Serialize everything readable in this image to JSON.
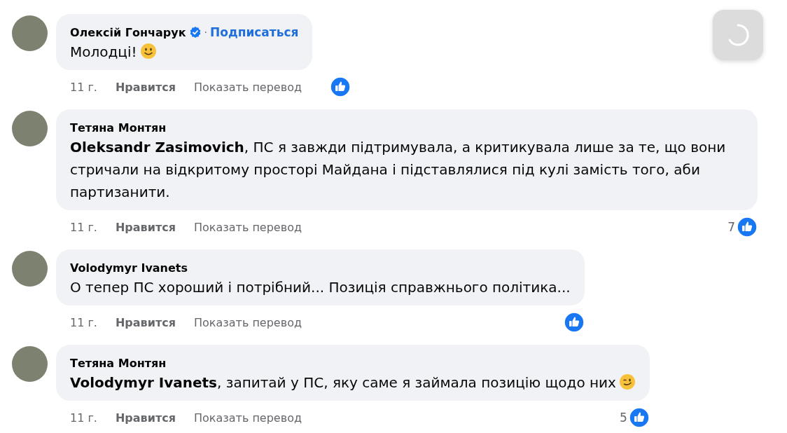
{
  "comments": [
    {
      "author": "Олексій Гончарук",
      "verified": true,
      "separator": "·",
      "follow_link": "Подписаться",
      "text": "Молодці!",
      "emoji": {
        "kind": "smile"
      },
      "time": "11 г.",
      "like": "Нравится",
      "translate": "Показать перевод"
    },
    {
      "author": "Тетяна Монтян",
      "text": "**Oleksandr Zasimovich**, ПС я завжди підтримувала, а критикувала лише за те, що вони стричали на відкритому просторі Майдана і підставлялися під кулі замість того, аби партизанити.",
      "time": "11 г.",
      "like": "Нравится",
      "translate": "Показать перевод",
      "reaction_count": "7"
    },
    {
      "author": "Volodymyr Ivanets",
      "text": "О тепер ПС хороший і потрібний... Позиція справжнього політика...",
      "time": "11 г.",
      "like": "Нравится",
      "translate": "Показать перевод"
    },
    {
      "author": "Тетяна Монтян",
      "text": "**Volodymyr Ivanets**, запитай у ПС, яку саме я займала позицію щодо них",
      "emoji": {
        "kind": "wink"
      },
      "time": "11 г.",
      "like": "Нравится",
      "translate": "Показать перевод",
      "reaction_count": "5"
    }
  ],
  "loading_overlay": {
    "visible": true
  }
}
